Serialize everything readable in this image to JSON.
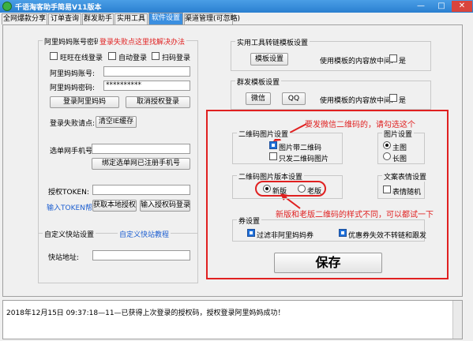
{
  "window": {
    "title": "千语淘客助手简易V11版本",
    "min": "—",
    "max": "□",
    "close": "✕"
  },
  "tabs": [
    "全网爆款分享",
    "订单查询",
    "群发助手",
    "实用工具",
    "软件设置",
    "渠道管理(可忽略)"
  ],
  "active_tab": "软件设置",
  "alimama": {
    "group_title": "阿里妈妈账号密码",
    "failure_link": "登录失败点这里找解决办法",
    "opt_wangwang": "旺旺在线登录",
    "opt_auto": "自动登录",
    "opt_scan": "扫码登录",
    "account_label": "阿里妈妈账号:",
    "account_value": "",
    "password_label": "阿里妈妈密码:",
    "password_value": "**********",
    "login_button": "登录阿里妈妈",
    "cancel_auth_button": "取消授权登录",
    "fail_label": "登录失败请点:",
    "clear_ie_button": "清空IE缓存",
    "phone_label": "选单网手机号:",
    "phone_value": "",
    "bind_phone_button": "绑定选单网已注册手机号",
    "token_label": "授权TOKEN:",
    "token_value": "",
    "token_help_link": "输入TOKEN帮助",
    "get_local_auth_button": "获取本地授权",
    "auth_code_login_button": "输入授权码登录"
  },
  "custom_link": {
    "group_title": "自定义快站设置",
    "tutorial_link": "自定义快站教程",
    "address_label": "快站地址:",
    "address_value": ""
  },
  "tools": {
    "group_title": "实用工具转链模板设置",
    "template_button": "模板设置",
    "use_template_label": "使用模板的内容放中间:",
    "yes_label": "是"
  },
  "group_send": {
    "group_title": "群发模板设置",
    "wechat_button": "微信",
    "qq_button": "QQ",
    "use_template_label": "使用模板的内容放中间:",
    "yes_label": "是"
  },
  "annotations": {
    "top_note": "要发微信二维码的，请勾选这个",
    "bottom_note": "新版和老版二维码的样式不同，可以都试一下"
  },
  "qr_settings": {
    "group_title": "二维码图片设置",
    "opt_with_qr": "图片带二维码",
    "opt_only_qr": "只发二维码图片"
  },
  "image_settings": {
    "group_title": "图片设置",
    "opt_main": "主图",
    "opt_long": "长图"
  },
  "qr_version": {
    "group_title": "二维码图片版本设置",
    "opt_new": "新版",
    "opt_old": "老版"
  },
  "emoji_settings": {
    "group_title": "文案表情设置",
    "opt_random": "表情随机"
  },
  "coupon_settings": {
    "group_title": "券设置",
    "opt_filter": "过滤非阿里妈妈券",
    "opt_no_convert": "优惠券失效不转链和跟发"
  },
  "save_button": "保存",
  "status_log": "2018年12月15日 09:37:18—11—已获得上次登录的授权码，授权登录阿里妈妈成功！",
  "colors": {
    "accent": "#3b8fe0",
    "annotation": "#e02020",
    "link": "#1c5ed0",
    "checked": "#1e6fd9"
  }
}
